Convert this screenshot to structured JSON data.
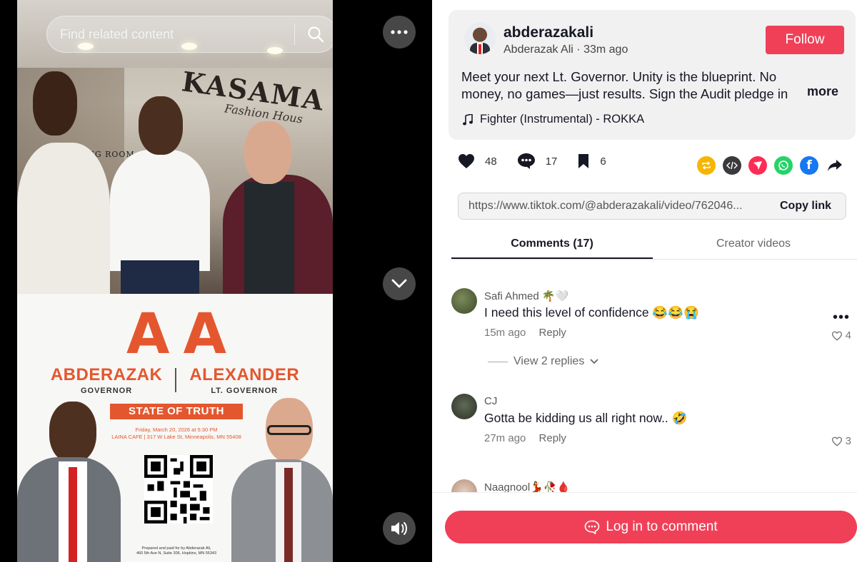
{
  "video": {
    "search_placeholder": "Find related content",
    "scene_sign": "KASAMA",
    "scene_sign_sub": "Fashion Hous",
    "scene_door_sign": "FITTING ROOM",
    "flyer": {
      "logo": "A A",
      "name_left": "ABDERAZAK",
      "role_left": "GOVERNOR",
      "name_right": "ALEXANDER",
      "role_right": "LT. GOVERNOR",
      "banner": "STATE OF TRUTH",
      "event_line1": "Friday, March 20, 2026 at 5:30 PM",
      "event_line2": "LAINA CAFE | 317 W Lake St, Minneapolis, MN 55408",
      "footer_line1": "Prepared and paid for by Abderazak Ali,",
      "footer_line2": "460 5th Ave N, Suite 306, Hopkins, MN 55343"
    }
  },
  "post": {
    "username": "abderazakali",
    "display_name": "Abderazak Ali",
    "time": "33m ago",
    "follow_label": "Follow",
    "caption": "Meet your next Lt. Governor. Unity is the blueprint. No money, no games—just results. Sign the Audit pledge in my bio.",
    "more_label": "more",
    "music": "Fighter (Instrumental) - ROKKA"
  },
  "actions": {
    "likes": "48",
    "comments": "17",
    "saves": "6"
  },
  "share_icons": [
    "repost-icon",
    "embed-icon",
    "send-icon",
    "whatsapp-icon",
    "facebook-icon",
    "share-arrow-icon"
  ],
  "link": {
    "url": "https://www.tiktok.com/@abderazakali/video/762046...",
    "copy_label": "Copy link"
  },
  "tabs": {
    "comments": "Comments (17)",
    "creator_videos": "Creator videos"
  },
  "comments": [
    {
      "name": "Safi Ahmed 🌴🤍",
      "text": "I need this level of confidence 😂😂😭",
      "time": "15m ago",
      "reply": "Reply",
      "likes": "4"
    },
    {
      "name": "CJ",
      "text": "Gotta be kidding us all right now.. 🤣",
      "time": "27m ago",
      "reply": "Reply",
      "likes": "3"
    },
    {
      "name": "Naagnool💃🥀🩸",
      "text": "",
      "time": "",
      "reply": "",
      "likes": ""
    }
  ],
  "view_replies": "View 2 replies",
  "login_label": "Log in to comment",
  "colors": {
    "accent": "#ef4058",
    "text": "#161823"
  }
}
